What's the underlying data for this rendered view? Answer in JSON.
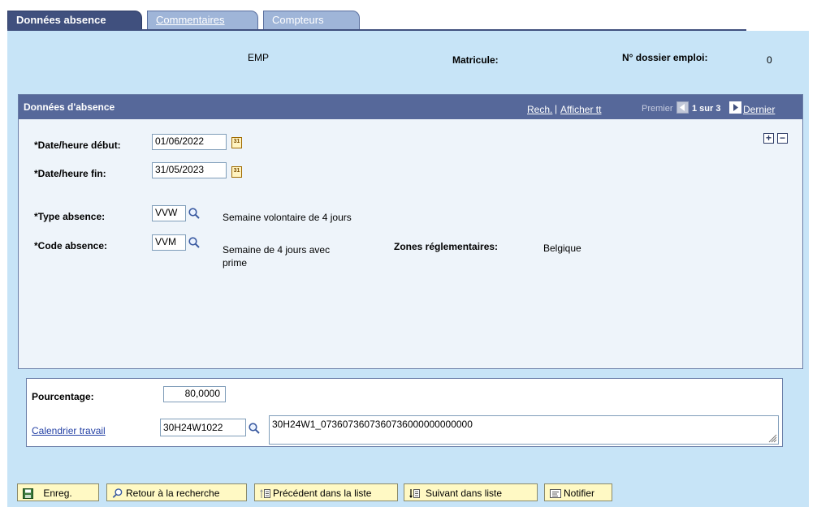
{
  "tabs": [
    {
      "label": "Données absence",
      "active": true
    },
    {
      "label": "Commentaires",
      "active": false
    },
    {
      "label": "Compteurs",
      "active": false
    }
  ],
  "header": {
    "emp_value": "EMP",
    "matricule_label": "Matricule:",
    "dossier_label": "N° dossier emploi:",
    "dossier_value": "0"
  },
  "group": {
    "title": "Données d'absence",
    "nav": {
      "search": "Rech.",
      "separator": "|",
      "show_all": "Afficher tt",
      "first": "Premier",
      "position": "1 sur 3",
      "last": "Dernier"
    }
  },
  "form": {
    "start_label": "*Date/heure début:",
    "start_value": "01/06/2022",
    "end_label": "*Date/heure fin:",
    "end_value": "31/05/2023",
    "type_label": "*Type absence:",
    "type_value": "VVW",
    "type_desc": "Semaine volontaire de 4 jours",
    "code_label": "*Code absence:",
    "code_value": "VVM",
    "code_desc_1": "Semaine de 4 jours avec",
    "code_desc_2": "prime",
    "zones_label": "Zones réglementaires:",
    "zones_value": "Belgique"
  },
  "lower": {
    "percent_label": "Pourcentage:",
    "percent_value": "80,0000",
    "calendar_link": "Calendrier travail",
    "calendar_code": "30H24W1022",
    "calendar_desc": "30H24W1_0736073607360736000000000000"
  },
  "toolbar": {
    "save": "Enreg.",
    "back": "Retour à la recherche",
    "prev": "Précédent dans la liste",
    "next": "Suivant dans liste",
    "notify": "Notifier"
  },
  "colors": {
    "page_bg": "#c7e4f7",
    "header_bar": "#56689a",
    "tab_active": "#40507e",
    "tab_inactive": "#9fb5d8",
    "button_bg": "#fff9c4",
    "link": "#223fa4"
  }
}
